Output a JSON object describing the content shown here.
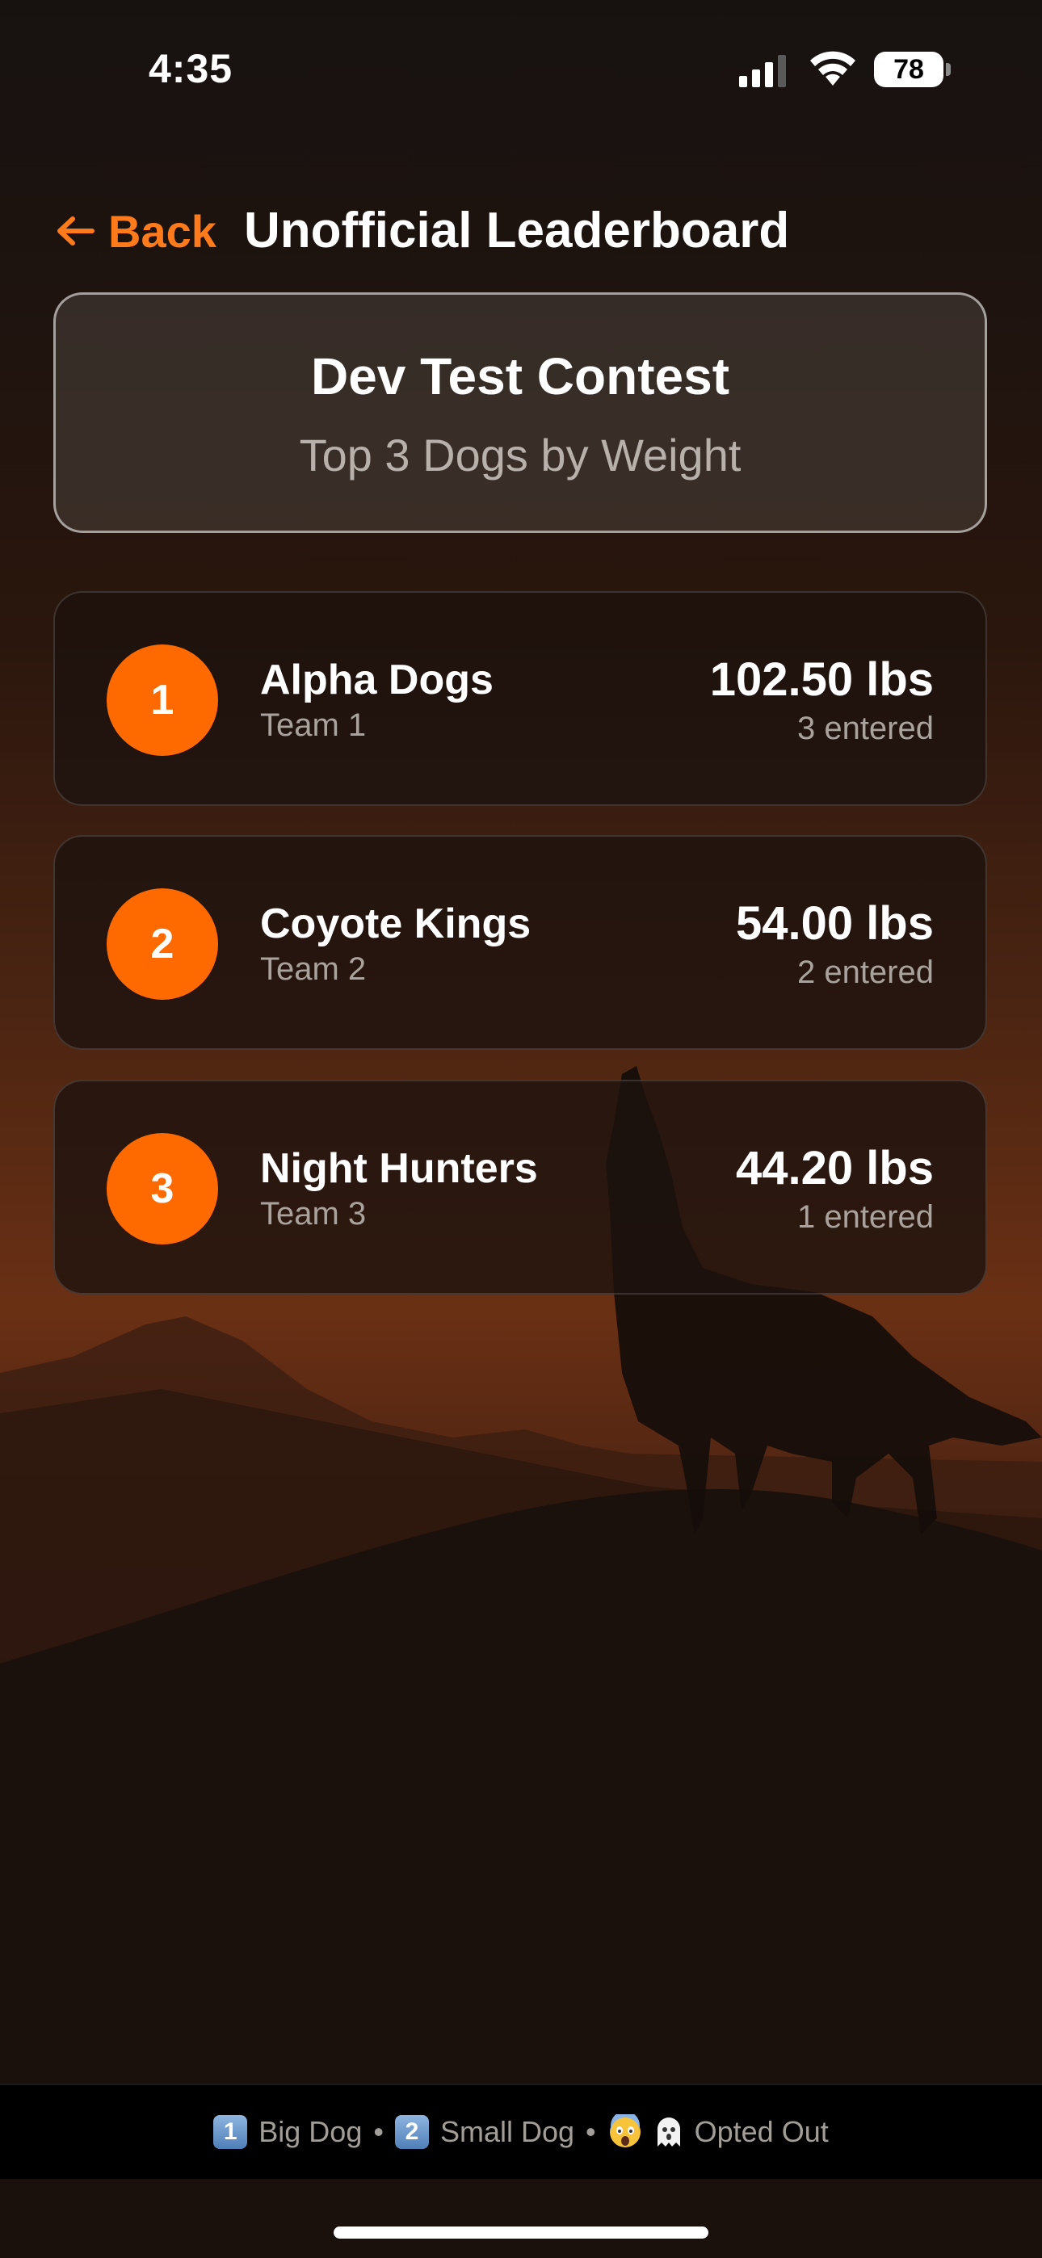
{
  "status_bar": {
    "time": "4:35",
    "battery": "78"
  },
  "header": {
    "back_label": "Back",
    "title": "Unofficial Leaderboard"
  },
  "contest": {
    "name": "Dev Test Contest",
    "subtitle": "Top 3 Dogs by Weight"
  },
  "leaderboard": [
    {
      "rank": "1",
      "name": "Alpha Dogs",
      "team": "Team 1",
      "weight": "102.50 lbs",
      "entered": "3 entered"
    },
    {
      "rank": "2",
      "name": "Coyote Kings",
      "team": "Team 2",
      "weight": "54.00 lbs",
      "entered": "2 entered"
    },
    {
      "rank": "3",
      "name": "Night Hunters",
      "team": "Team 3",
      "weight": "44.20 lbs",
      "entered": "1 entered"
    }
  ],
  "legend": {
    "key_one": "1",
    "big_dog": "Big Dog",
    "separator": "•",
    "key_two": "2",
    "small_dog": "Small Dog",
    "opted_out": "Opted Out"
  },
  "colors": {
    "accent": "#ff6a00",
    "back_accent": "#ff7a1a"
  },
  "icons": [
    "signal-icon",
    "wifi-icon",
    "battery-icon",
    "back-arrow-icon",
    "scream-emoji-icon",
    "ghost-emoji-icon"
  ]
}
